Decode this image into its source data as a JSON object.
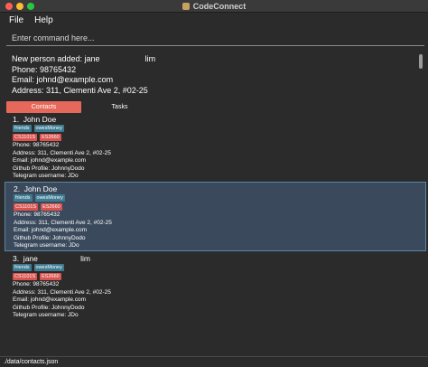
{
  "window": {
    "title": "CodeConnect"
  },
  "menu": {
    "file": "File",
    "help": "Help"
  },
  "command": {
    "placeholder": "Enter command here..."
  },
  "result": {
    "lines": [
      "New person added: jane                    lim",
      "Phone: 98765432",
      "Email: johnd@example.com",
      "Address: 311, Clementi Ave 2, #02-25"
    ]
  },
  "tabs": {
    "contacts": "Contacts",
    "tasks": "Tasks"
  },
  "contacts": [
    {
      "header": "1.  John Doe",
      "tags": [
        "friends",
        "owesMoney"
      ],
      "modules": [
        "CS1101S",
        "ES2660"
      ],
      "phone": "Phone: 98765432",
      "address": "Address: 311, Clementi Ave 2, #02-25",
      "email": "Email: johnd@example.com",
      "github": "Github Profile: JohnnyDodo",
      "telegram": "Telegram username: JDo"
    },
    {
      "header": "2.  John Doe",
      "tags": [
        "friends",
        "owesMoney"
      ],
      "modules": [
        "CS1101S",
        "ES2660"
      ],
      "phone": "Phone: 98765432",
      "address": "Address: 311, Clementi Ave 2, #02-25",
      "email": "Email: johnd@example.com",
      "github": "Github Profile: JohnnyDodo",
      "telegram": "Telegram username: JDo"
    },
    {
      "header": "3.  jane                    lim",
      "tags": [
        "friends",
        "owesMoney"
      ],
      "modules": [
        "CS1101S",
        "ES2660"
      ],
      "phone": "Phone: 98765432",
      "address": "Address: 311, Clementi Ave 2, #02-25",
      "email": "Email: johnd@example.com",
      "github": "Github Profile: JohnnyDodo",
      "telegram": "Telegram username: JDo"
    }
  ],
  "status": {
    "path": "./data/contacts.json"
  },
  "colors": {
    "accent": "#e5685a",
    "tag_blue": "#3e7b91",
    "tag_red": "#d9534f",
    "selected": "#3a4a5c"
  }
}
